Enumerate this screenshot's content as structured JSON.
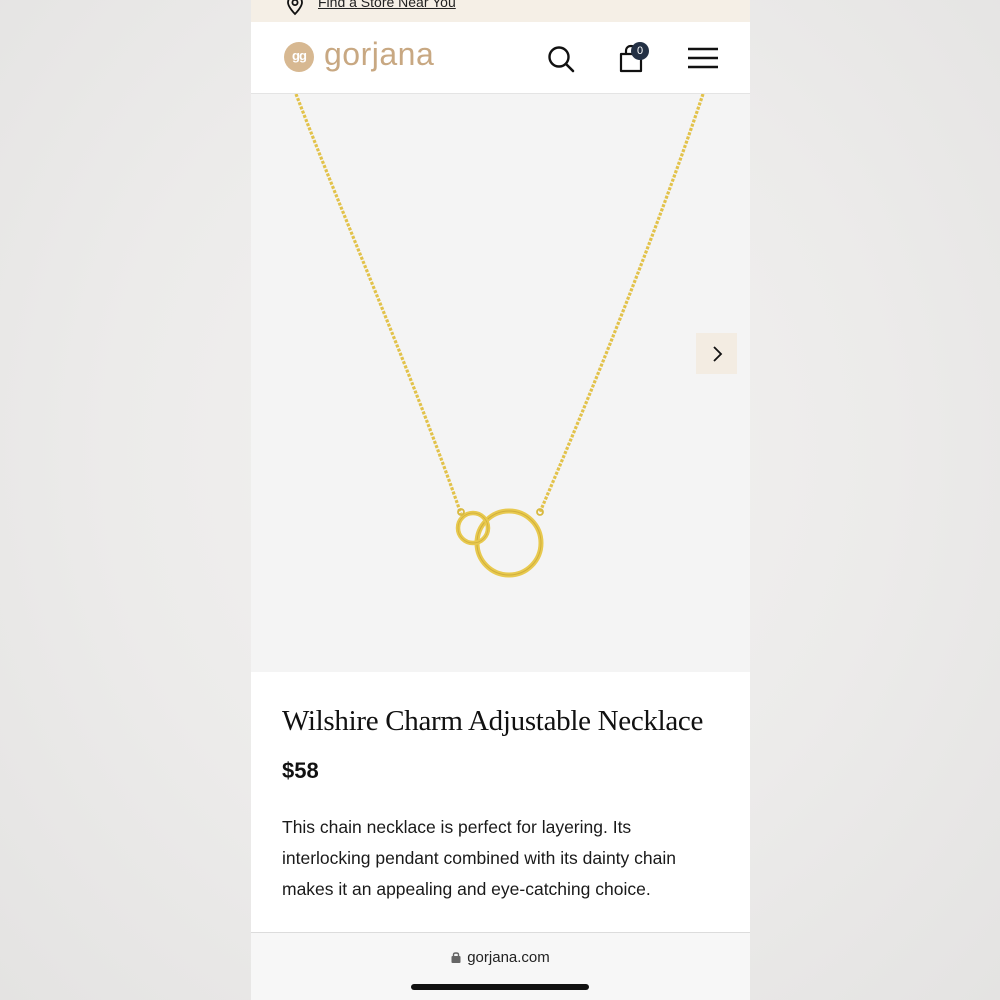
{
  "store_bar": {
    "link_text": "Find a Store Near You",
    "icon": "location-pin-icon"
  },
  "header": {
    "logo_mark": "gg",
    "logo_text": "gorjana",
    "cart_count": "0",
    "icons": [
      "search-icon",
      "shopping-bag-icon",
      "hamburger-menu-icon"
    ]
  },
  "gallery": {
    "next_icon": "chevron-right-icon"
  },
  "product": {
    "title": "Wilshire Charm Adjustable Necklace",
    "price": "$58",
    "description": "This chain necklace is perfect for layering. Its interlocking pendant combined with its dainty chain makes it an appealing and eye-catching choice."
  },
  "browser": {
    "url": "gorjana.com"
  },
  "colors": {
    "brand": "#c8a882",
    "store_bar_bg": "#f5efe6",
    "cart_badge": "#233044",
    "gold": "#e2c24a"
  }
}
